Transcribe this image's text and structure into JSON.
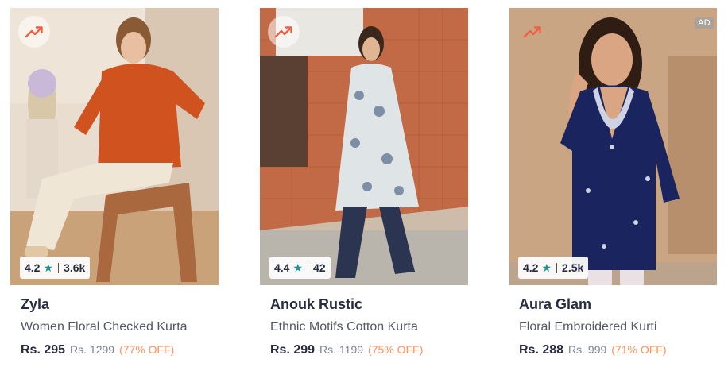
{
  "products": [
    {
      "brand": "Zyla",
      "title": "Women Floral Checked Kurta",
      "rating": "4.2",
      "rating_count": "3.6k",
      "price": "Rs. 295",
      "mrp": "Rs. 1299",
      "discount": "(77% OFF)",
      "trending_icon": "trending-up-icon"
    },
    {
      "brand": "Anouk Rustic",
      "title": "Ethnic Motifs Cotton Kurta",
      "rating": "4.4",
      "rating_count": "42",
      "price": "Rs. 299",
      "mrp": "Rs. 1199",
      "discount": "(75% OFF)",
      "trending_icon": "trending-up-icon"
    },
    {
      "brand": "Aura Glam",
      "title": "Floral Embroidered Kurti",
      "rating": "4.2",
      "rating_count": "2.5k",
      "price": "Rs. 288",
      "mrp": "Rs. 999",
      "discount": "(71% OFF)",
      "trending_icon": "trending-up-icon",
      "ad_label": "AD"
    }
  ],
  "colors": {
    "rating_star": "#14958f",
    "discount": "#ff905a",
    "trend_icon": "#ee5f45"
  }
}
